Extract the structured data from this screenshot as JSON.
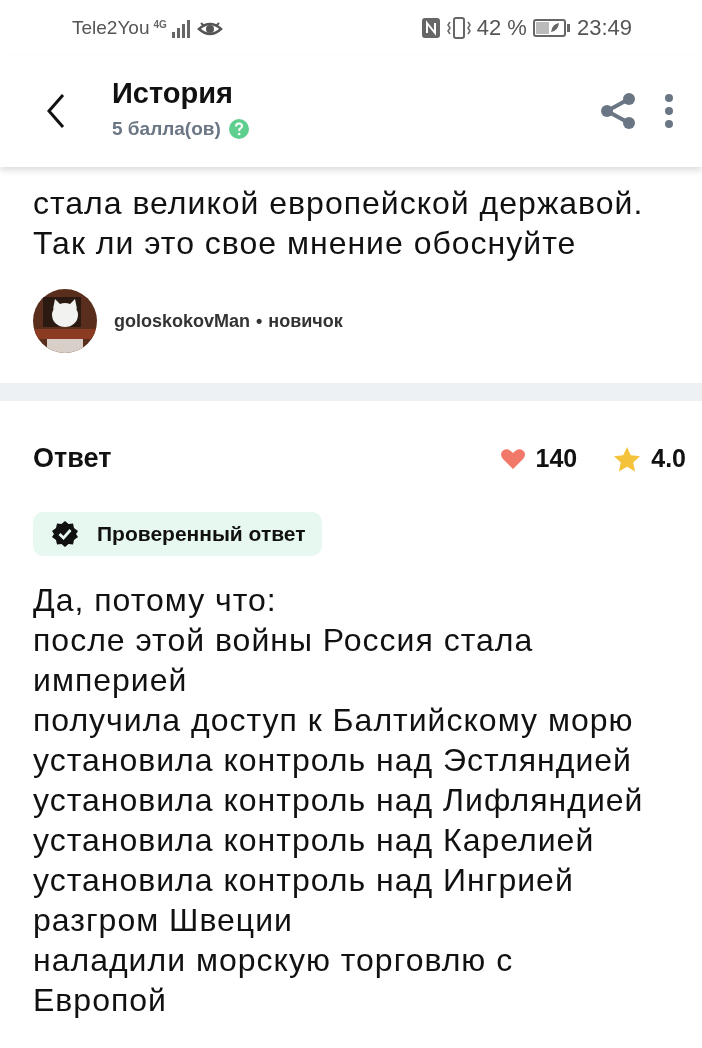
{
  "status_bar": {
    "carrier": "Tele2You",
    "network": "4G",
    "battery": "42 %",
    "time": "23:49"
  },
  "header": {
    "title": "История",
    "points": "5 балла(ов)"
  },
  "question": {
    "lines": [
      "стала великой европейской державой.",
      "Так ли это свое мнение обоснуйте"
    ],
    "author": {
      "name": "goloskokovMan",
      "separator": "•",
      "rank": "новичок"
    }
  },
  "answer": {
    "title": "Ответ",
    "likes": "140",
    "rating": "4.0",
    "badge": "Проверенный ответ",
    "lines": [
      "Да, потому что:",
      "после этой войны Россия стала империей",
      "получила доступ к Балтийскому морю",
      "установила контроль над Эстляндией",
      "установила контроль над Лифляндией",
      "установила контроль над Карелией",
      "установила контроль над Ингрией",
      "разгром Швеции",
      "наладили морскую торговлю с Европой"
    ]
  }
}
